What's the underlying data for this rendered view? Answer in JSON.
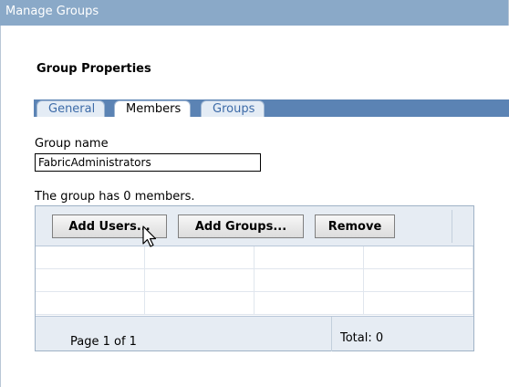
{
  "window": {
    "title": "Manage Groups"
  },
  "section": {
    "title": "Group Properties"
  },
  "tabs": [
    {
      "label": "General",
      "active": false
    },
    {
      "label": "Members",
      "active": true
    },
    {
      "label": "Groups",
      "active": false
    }
  ],
  "group_name": {
    "label": "Group name",
    "value": "FabricAdministrators"
  },
  "members": {
    "summary": "The group has 0 members.",
    "toolbar": {
      "add_users_label": "Add Users...",
      "add_groups_label": "Add Groups...",
      "remove_label": "Remove"
    },
    "footer": {
      "page_label": "Page 1 of 1",
      "total_label": "Total: 0"
    }
  },
  "colors": {
    "title_bar": "#8aa9c8",
    "tab_bar": "#5b83b4",
    "tab_inactive_text": "#3d6ba8",
    "toolbar_bg": "#e6ecf3"
  },
  "icons": {
    "pointer": "arrow-cursor-icon"
  }
}
